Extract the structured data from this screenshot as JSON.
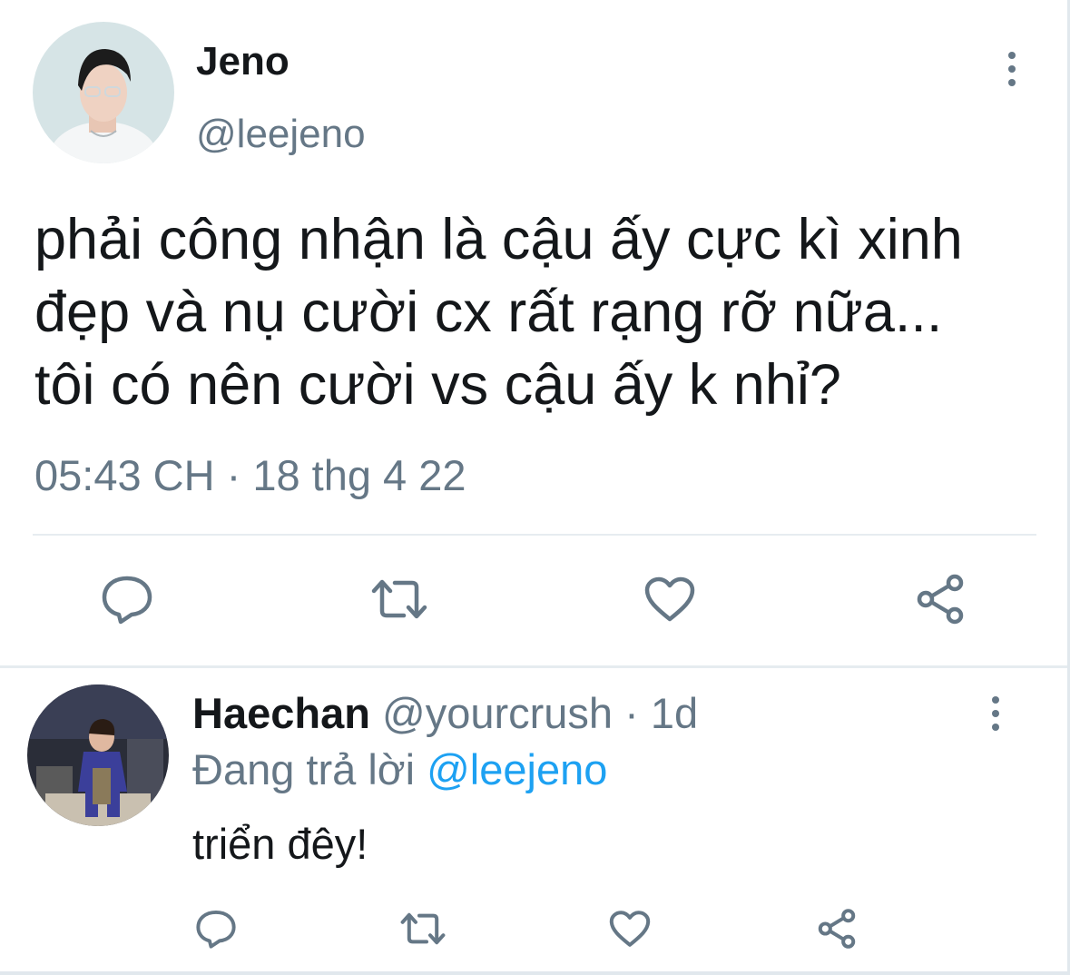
{
  "main_tweet": {
    "author_name": "Jeno",
    "handle": "@leejeno",
    "text_lines": [
      "phải công nhận là cậu ấy cực kì xinh",
      "đẹp và nụ cười cx rất rạng rỡ nữa...",
      "tôi có nên cười vs cậu ấy k nhỉ?"
    ],
    "timestamp": "05:43 CH · 18 thg 4 22",
    "actions": [
      "reply-icon",
      "retweet-icon",
      "like-icon",
      "share-icon"
    ]
  },
  "reply": {
    "author_name": "Haechan",
    "handle": "@yourcrush",
    "time": "· 1d",
    "replying_prefix": "Đang trả lời",
    "replying_to": "@leejeno",
    "text": "triển đêy!",
    "actions": [
      "reply-icon",
      "retweet-icon",
      "like-icon",
      "share-icon"
    ]
  },
  "colors": {
    "text": "#14171a",
    "muted": "#657786",
    "link": "#1da1f2",
    "divider": "#e6ecf0"
  }
}
